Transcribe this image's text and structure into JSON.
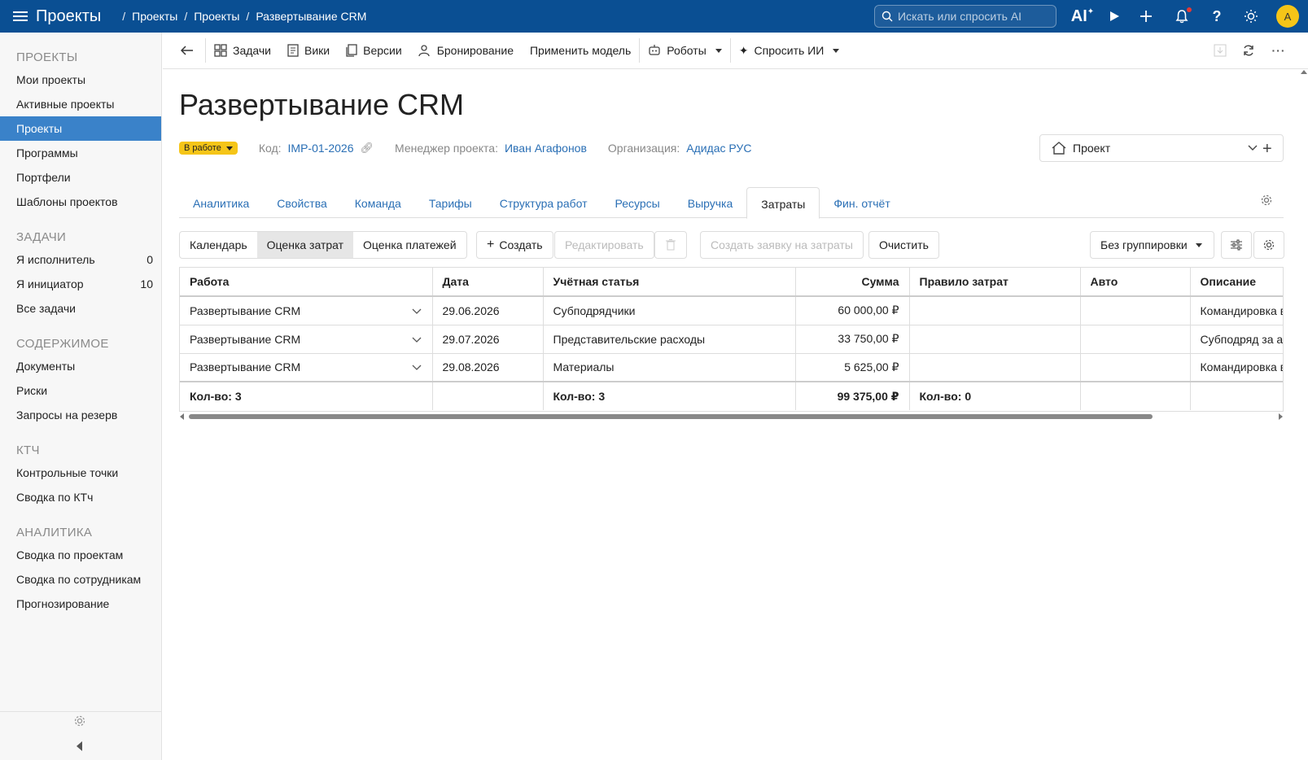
{
  "topbar": {
    "app_title": "Проекты",
    "breadcrumbs": [
      "Проекты",
      "Проекты",
      "Развертывание CRM"
    ],
    "search_placeholder": "Искать или спросить AI",
    "ai_label": "AI",
    "avatar_initial": "А"
  },
  "sidebar": {
    "sections": [
      {
        "title": "ПРОЕКТЫ",
        "items": [
          {
            "label": "Мои проекты",
            "count": ""
          },
          {
            "label": "Активные проекты",
            "count": ""
          },
          {
            "label": "Проекты",
            "count": "",
            "active": true
          },
          {
            "label": "Программы",
            "count": ""
          },
          {
            "label": "Портфели",
            "count": ""
          },
          {
            "label": "Шаблоны проектов",
            "count": ""
          }
        ]
      },
      {
        "title": "ЗАДАЧИ",
        "items": [
          {
            "label": "Я исполнитель",
            "count": "0"
          },
          {
            "label": "Я инициатор",
            "count": "10"
          },
          {
            "label": "Все задачи",
            "count": ""
          }
        ]
      },
      {
        "title": "СОДЕРЖИМОЕ",
        "items": [
          {
            "label": "Документы",
            "count": ""
          },
          {
            "label": "Риски",
            "count": ""
          },
          {
            "label": "Запросы на резерв",
            "count": ""
          }
        ]
      },
      {
        "title": "КТЧ",
        "items": [
          {
            "label": "Контрольные точки",
            "count": ""
          },
          {
            "label": "Сводка по КТч",
            "count": ""
          }
        ]
      },
      {
        "title": "АНАЛИТИКА",
        "items": [
          {
            "label": "Сводка по проектам",
            "count": ""
          },
          {
            "label": "Сводка по сотрудникам",
            "count": ""
          },
          {
            "label": "Прогнозирование",
            "count": ""
          }
        ]
      }
    ]
  },
  "toolbar": {
    "tasks": "Задачи",
    "wiki": "Вики",
    "versions": "Версии",
    "booking": "Бронирование",
    "apply_model": "Применить модель",
    "robots": "Роботы",
    "ask_ai": "Спросить ИИ"
  },
  "project": {
    "title": "Развертывание CRM",
    "status": "В работе",
    "code_label": "Код:",
    "code": "IMP-01-2026",
    "manager_label": "Менеджер проекта:",
    "manager": "Иван Агафонов",
    "org_label": "Организация:",
    "org": "Адидас РУС",
    "type_select": "Проект"
  },
  "tabs": [
    "Аналитика",
    "Свойства",
    "Команда",
    "Тарифы",
    "Структура работ",
    "Ресурсы",
    "Выручка",
    "Затраты",
    "Фин. отчёт"
  ],
  "active_tab": "Затраты",
  "subbar": {
    "views": [
      "Календарь",
      "Оценка затрат",
      "Оценка платежей"
    ],
    "active_view": "Оценка затрат",
    "create": "Создать",
    "edit": "Редактировать",
    "create_request": "Создать заявку на затраты",
    "clear": "Очистить",
    "grouping": "Без группировки"
  },
  "table": {
    "columns": [
      "Работа",
      "Дата",
      "Учётная статья",
      "Сумма",
      "Правило затрат",
      "Авто",
      "Описание"
    ],
    "rows": [
      {
        "work": "Развертывание CRM",
        "date": "29.06.2026",
        "article": "Субподрядчики",
        "sum": "60 000,00 ₽",
        "rule": "",
        "auto": "",
        "desc": "Командировка в"
      },
      {
        "work": "Развертывание CRM",
        "date": "29.07.2026",
        "article": "Представительские расходы",
        "sum": "33 750,00 ₽",
        "rule": "",
        "auto": "",
        "desc": "Субподряд за аг"
      },
      {
        "work": "Развертывание CRM",
        "date": "29.08.2026",
        "article": "Материалы",
        "sum": "5 625,00 ₽",
        "rule": "",
        "auto": "",
        "desc": "Командировка в"
      }
    ],
    "totals": {
      "work": "Кол-во: 3",
      "date": "",
      "article": "Кол-во: 3",
      "sum": "99 375,00 ₽",
      "rule": "Кол-во: 0",
      "auto": "",
      "desc": ""
    }
  },
  "colors": {
    "topbar": "#0a4f93",
    "accent": "#3a82c9",
    "link": "#2a6fb5",
    "status": "#f5c518"
  }
}
